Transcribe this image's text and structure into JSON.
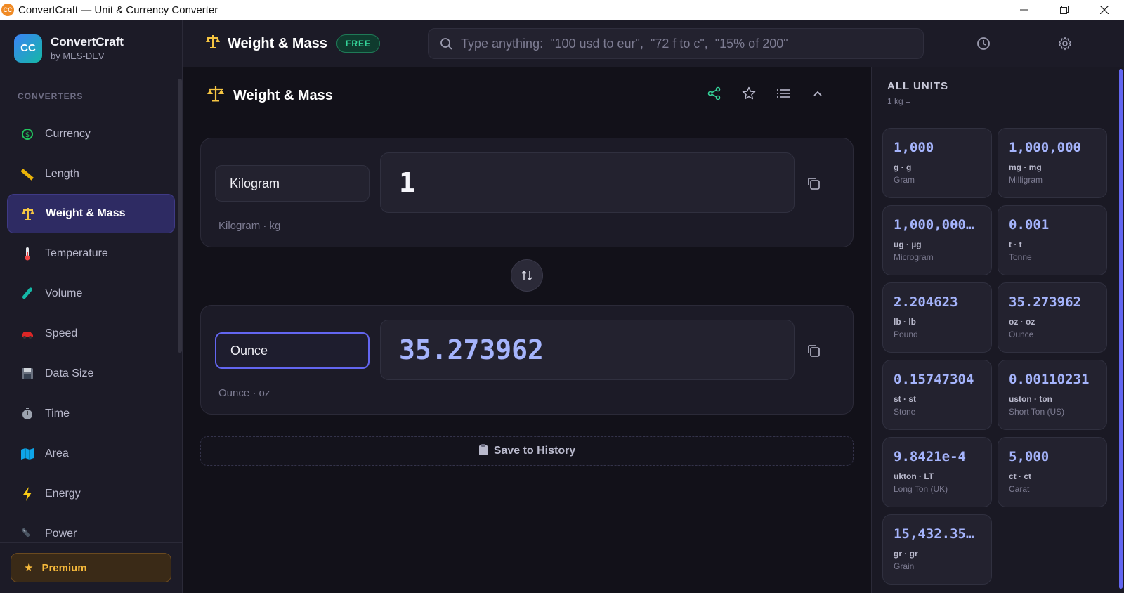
{
  "window": {
    "title": "ConvertCraft — Unit & Currency Converter",
    "icon_text": "CC"
  },
  "brand": {
    "logo": "CC",
    "name": "ConvertCraft",
    "by": "by MES-DEV"
  },
  "sidebar": {
    "section_label": "CONVERTERS",
    "items": [
      {
        "label": "Currency",
        "icon": "currency-icon"
      },
      {
        "label": "Length",
        "icon": "ruler-icon"
      },
      {
        "label": "Weight & Mass",
        "icon": "scale-icon",
        "active": true
      },
      {
        "label": "Temperature",
        "icon": "thermometer-icon"
      },
      {
        "label": "Volume",
        "icon": "test-tube-icon"
      },
      {
        "label": "Speed",
        "icon": "car-icon"
      },
      {
        "label": "Data Size",
        "icon": "floppy-disk-icon"
      },
      {
        "label": "Time",
        "icon": "stopwatch-icon"
      },
      {
        "label": "Area",
        "icon": "map-icon"
      },
      {
        "label": "Energy",
        "icon": "lightning-icon"
      },
      {
        "label": "Power",
        "icon": "plug-icon"
      }
    ],
    "premium_label": "Premium"
  },
  "topbar": {
    "title": "Weight & Mass",
    "badge": "FREE",
    "search_placeholder": "Type anything:  \"100 usd to eur\",  \"72 f to c\",  \"15% of 200\""
  },
  "main": {
    "title": "Weight & Mass",
    "from": {
      "unit": "Kilogram",
      "value": "1",
      "sub": "Kilogram · kg"
    },
    "to": {
      "unit": "Ounce",
      "value": "35.273962",
      "sub": "Ounce · oz"
    },
    "save_label": "Save to History"
  },
  "all_units": {
    "title": "ALL UNITS",
    "subtitle": "1 kg =",
    "cards": [
      {
        "value": "1,000",
        "symbol": "g · g",
        "name": "Gram"
      },
      {
        "value": "1,000,000",
        "symbol": "mg · mg",
        "name": "Milligram"
      },
      {
        "value": "1,000,000…",
        "symbol": "ug · µg",
        "name": "Microgram"
      },
      {
        "value": "0.001",
        "symbol": "t · t",
        "name": "Tonne"
      },
      {
        "value": "2.204623",
        "symbol": "lb · lb",
        "name": "Pound"
      },
      {
        "value": "35.273962",
        "symbol": "oz · oz",
        "name": "Ounce"
      },
      {
        "value": "0.15747304",
        "symbol": "st · st",
        "name": "Stone"
      },
      {
        "value": "0.00110231",
        "symbol": "uston · ton",
        "name": "Short Ton (US)"
      },
      {
        "value": "9.8421e-4",
        "symbol": "ukton · LT",
        "name": "Long Ton (UK)"
      },
      {
        "value": "5,000",
        "symbol": "ct · ct",
        "name": "Carat"
      },
      {
        "value": "15,432.35…",
        "symbol": "gr · gr",
        "name": "Grain"
      }
    ]
  },
  "colors": {
    "accent": "#6366f1",
    "result": "#a5b4fc",
    "free_badge": "#34d399",
    "premium": "#f6b93b"
  }
}
